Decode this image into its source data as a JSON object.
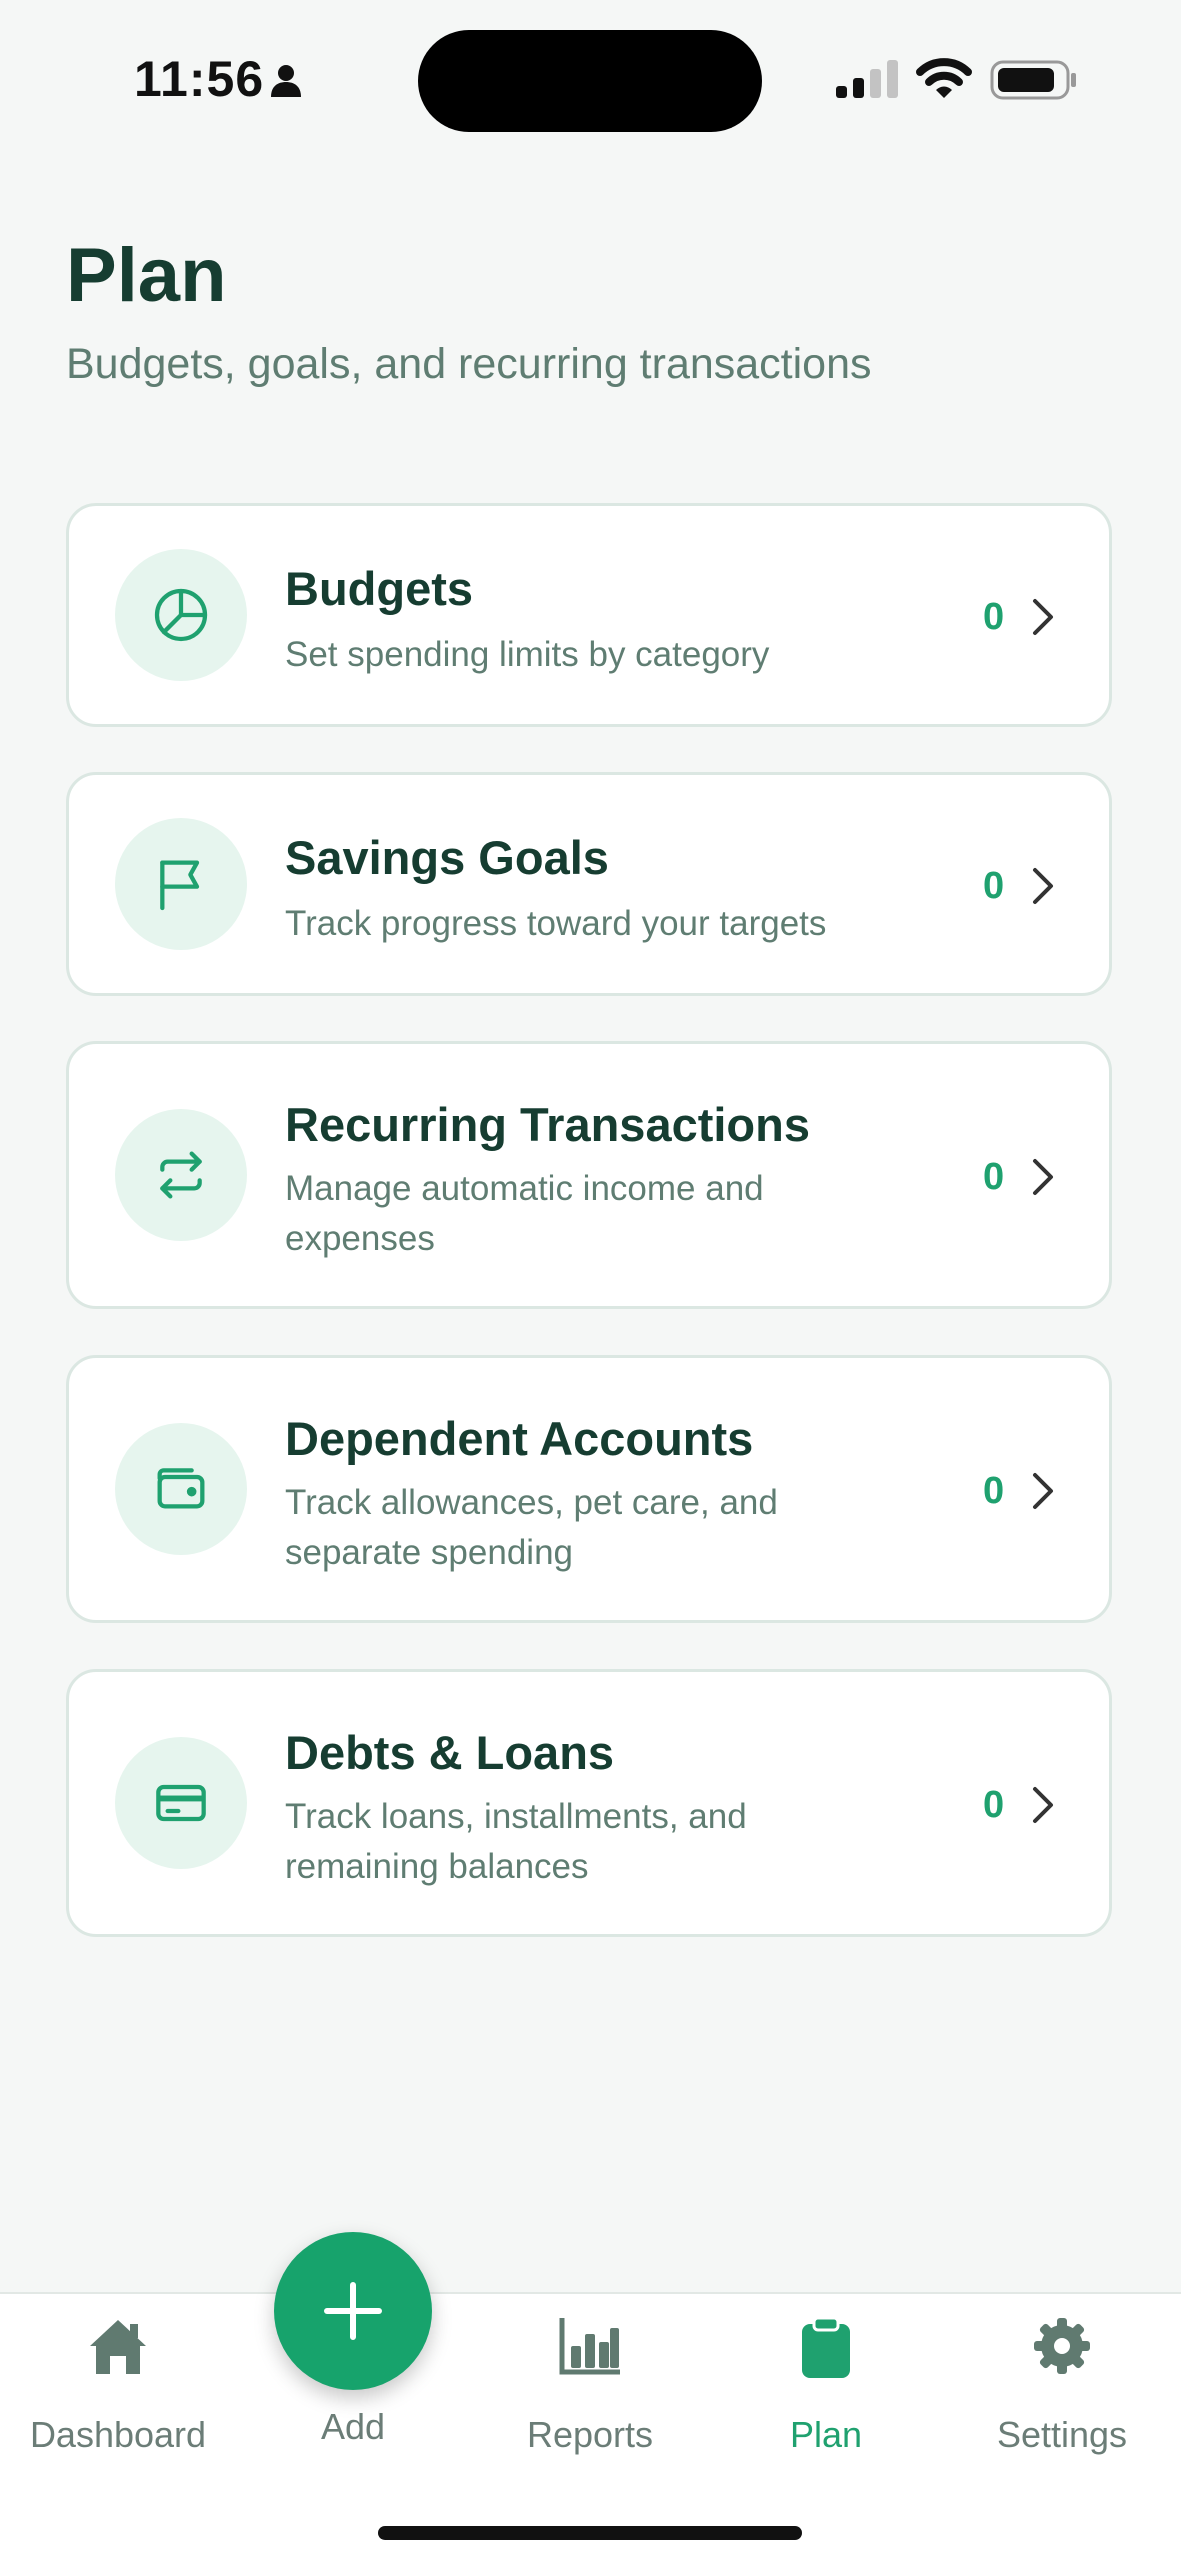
{
  "status_bar": {
    "time": "11:56"
  },
  "header": {
    "title": "Plan",
    "subtitle": "Budgets, goals, and recurring transactions"
  },
  "cards": [
    {
      "title": "Budgets",
      "description": "Set spending limits by category",
      "count": "0",
      "icon": "pie-chart-icon"
    },
    {
      "title": "Savings Goals",
      "description": "Track progress toward your targets",
      "count": "0",
      "icon": "flag-icon"
    },
    {
      "title": "Recurring Transactions",
      "description": "Manage automatic income and expenses",
      "count": "0",
      "icon": "repeat-icon"
    },
    {
      "title": "Dependent Accounts",
      "description": "Track allowances, pet care, and separate spending",
      "count": "0",
      "icon": "wallet-icon"
    },
    {
      "title": "Debts & Loans",
      "description": "Track loans, installments, and remaining balances",
      "count": "0",
      "icon": "credit-card-icon"
    }
  ],
  "tab_bar": {
    "tabs": [
      {
        "label": "Dashboard",
        "icon": "home-icon",
        "active": false
      },
      {
        "label": "Add",
        "icon": "plus-icon",
        "active": false
      },
      {
        "label": "Reports",
        "icon": "bar-chart-icon",
        "active": false
      },
      {
        "label": "Plan",
        "icon": "clipboard-icon",
        "active": true
      },
      {
        "label": "Settings",
        "icon": "gear-icon",
        "active": false
      }
    ]
  },
  "colors": {
    "accent": "#1fa16f",
    "title": "#163d31",
    "muted": "#5f7d72",
    "background": "#f5f7f6"
  }
}
